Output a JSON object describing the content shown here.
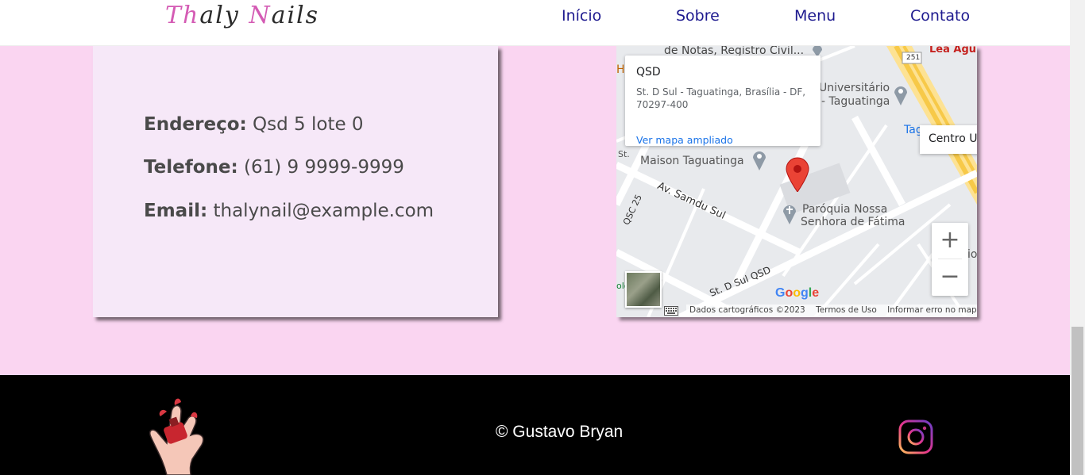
{
  "nav": {
    "logo_first": "Th",
    "logo_mid": "a",
    "logo_ly": "ly",
    "logo_space": " ",
    "logo_n": "N",
    "logo_rest": "ails",
    "links": [
      "Início",
      "Sobre",
      "Menu",
      "Contato"
    ]
  },
  "contact": {
    "address_label": "Endereço:",
    "address_value": "Qsd 5 lote 0",
    "phone_label": "Telefone:",
    "phone_value": "(61) 9 9999-9999",
    "email_label": "Email:",
    "email_value": "thalynail@example.com"
  },
  "map": {
    "info_title": "QSD",
    "info_address": "St. D Sul - Taguatinga, Brasília - DF, 70297-400",
    "info_link": "Ver mapa ampliado",
    "centro_label": "Centro Un",
    "labels": {
      "notas": "de Notas, Registro Civil...",
      "universitario_1": "Universitário",
      "universitario_2": "- Taguatinga",
      "maison": "Maison Taguatinga",
      "samdu": "Av. Samdu Sul",
      "qsc": "QSC 25",
      "paroquia_1": "Paróquia Nossa",
      "paroquia_2": "Senhora de Fátima",
      "st_d_sul": "St. D Sul QSD",
      "lea": "Lea Agu",
      "tag": "Tag",
      "route": "251",
      "h": "H",
      "io": "io",
      "st": "St.",
      "olo": "olo"
    },
    "zoom_in": "+",
    "zoom_out": "−",
    "google": "Google",
    "attribution": [
      "Dados cartográficos ©2023",
      "Termos de Uso",
      "Informar erro no mapa"
    ]
  },
  "footer": {
    "copyright": "© Gustavo Bryan"
  },
  "colors": {
    "page_bg": "#fad5f1",
    "card_bg": "#f6e8f8",
    "nav_link": "#1e1a8f",
    "logo_pink": "#d45bb4"
  },
  "icons": {
    "hand": "nail-polish-hand-icon",
    "instagram": "instagram-icon",
    "pin": "map-pin-icon",
    "keyboard": "keyboard-icon"
  }
}
